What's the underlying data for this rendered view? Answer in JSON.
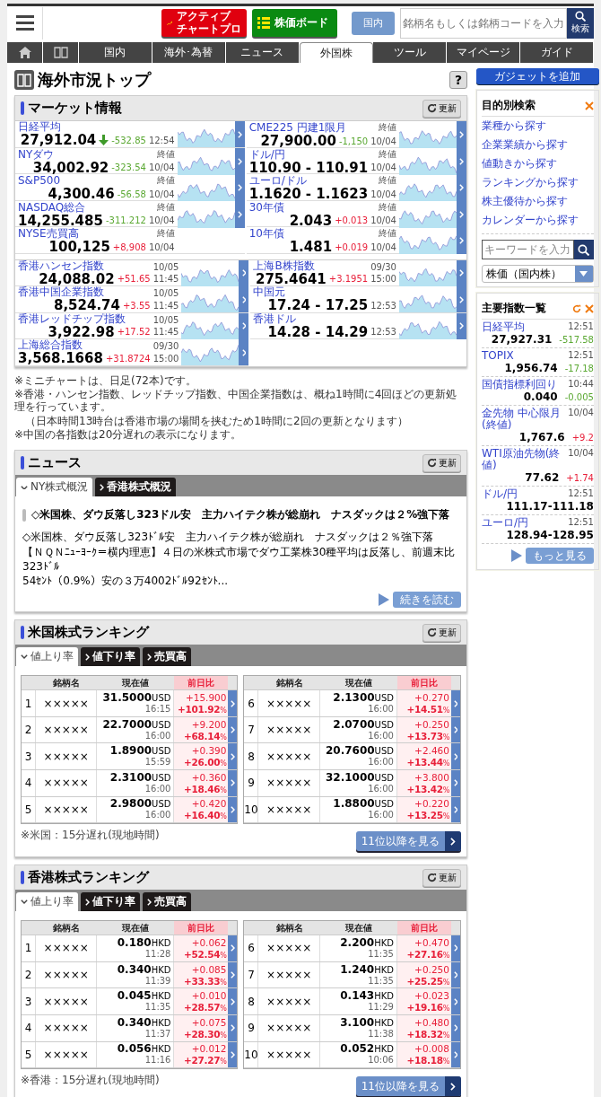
{
  "header": {
    "chart_button_lines": [
      "アクティブ",
      "チャートプロ"
    ],
    "board_button": "株価ボード",
    "market_button": "国内",
    "search_placeholder": "銘柄名もしくは銘柄コードを入力",
    "search_button": "検索"
  },
  "nav": [
    {
      "kind": "home",
      "selected": false
    },
    {
      "kind": "book",
      "selected": false
    },
    {
      "label": "国内",
      "selected": false
    },
    {
      "label": "海外･為替",
      "selected": false
    },
    {
      "label": "ニュース",
      "selected": false
    },
    {
      "label": "外国株",
      "selected": true
    },
    {
      "label": "ツール",
      "selected": false
    },
    {
      "label": "マイページ",
      "selected": false
    },
    {
      "label": "ガイド",
      "selected": false
    }
  ],
  "page_title": "海外市況トップ",
  "help_button": "?",
  "market": {
    "title": "マーケット情報",
    "update_label": "更新",
    "blocks": [
      {
        "left": [
          {
            "name": "日経平均",
            "value": "27,912.04",
            "arrow_icon": true,
            "change": "-532.85",
            "rising": false,
            "label_bottom": "12:54",
            "has_chart": true
          },
          {
            "name": "NYダウ",
            "value": "34,002.92",
            "change": "-323.54",
            "rising": false,
            "label_top": "終値",
            "label_bottom": "10/04",
            "has_chart": true
          },
          {
            "name": "S&P500",
            "value": "4,300.46",
            "change": "-56.58",
            "rising": false,
            "label_top": "終値",
            "label_bottom": "10/04",
            "has_chart": true
          },
          {
            "name": "NASDAQ総合",
            "value": "14,255.485",
            "change": "-311.212",
            "rising": false,
            "label_top": "終値",
            "label_bottom": "10/04",
            "has_chart": true
          },
          {
            "name": "NYSE売買高",
            "value": "100,125",
            "change": "+8,908",
            "rising": true,
            "label_top": "終値",
            "label_bottom": "10/04",
            "has_chart": false
          }
        ],
        "right": [
          {
            "name": "CME225 円建1限月",
            "value": "27,900.00",
            "change": "-1,150",
            "rising": false,
            "label_top": "終値",
            "label_bottom": "10/04",
            "has_chart": true
          },
          {
            "name": "ドル/円",
            "value": "110.90 - 110.91",
            "label_top": "終値",
            "label_bottom": "10/04",
            "has_chart": true
          },
          {
            "name": "ユーロ/ドル",
            "value": "1.1620 - 1.1623",
            "label_top": "終値",
            "label_bottom": "10/04",
            "has_chart": true
          },
          {
            "name": "30年債",
            "value": "2.043",
            "change": "+0.013",
            "rising": true,
            "label_top": "終値",
            "label_bottom": "10/04",
            "has_chart": true
          },
          {
            "name": "10年債",
            "value": "1.481",
            "change": "+0.019",
            "rising": true,
            "label_top": "終値",
            "label_bottom": "10/04",
            "has_chart": true
          }
        ]
      },
      {
        "left": [
          {
            "name": "香港ハンセン指数",
            "value": "24,088.02",
            "change": "+51.65",
            "rising": true,
            "label_top": "10/05",
            "label_bottom": "11:45",
            "has_chart": true
          },
          {
            "name": "香港中国企業指数",
            "value": "8,524.74",
            "change": "+3.55",
            "rising": true,
            "label_top": "10/05",
            "label_bottom": "11:45",
            "has_chart": true
          },
          {
            "name": "香港レッドチップ指数",
            "value": "3,922.98",
            "change": "+17.52",
            "rising": true,
            "label_top": "10/05",
            "label_bottom": "11:45",
            "has_chart": true
          },
          {
            "name": "上海総合指数",
            "value": "3,568.1668",
            "change": "+31.8724",
            "rising": true,
            "label_top": "09/30",
            "label_bottom": "15:00",
            "has_chart": true
          }
        ],
        "right": [
          {
            "name": "上海B株指数",
            "value": "275.4641",
            "change": "+3.1951",
            "rising": true,
            "label_top": "09/30",
            "label_bottom": "15:00",
            "has_chart": true
          },
          {
            "name": "中国元",
            "value": "17.24 - 17.25",
            "label_bottom": "12:53",
            "has_chart": true
          },
          {
            "name": "香港ドル",
            "value": "14.28 - 14.29",
            "label_bottom": "12:53",
            "has_chart": true
          }
        ]
      }
    ]
  },
  "notes": [
    "※ミニチャートは、日足(72本)です。",
    "※香港・ハンセン指数、レッドチップ指数、中国企業指数は、概ね1時間に4回ほどの更新処理を行っています。",
    "（日本時間13時台は香港市場の場間を挟むため1時間に2回の更新となります）",
    "※中国の各指数は20分遅れの表示になります。"
  ],
  "news": {
    "title": "ニュース",
    "update_label": "更新",
    "tabs": [
      {
        "label": "NY株式概況",
        "selected": true
      },
      {
        "label": "香港株式概況",
        "selected": false
      }
    ],
    "headline": "◇米国株、ダウ反落し323ドル安　主力ハイテク株が総崩れ　ナスダックは２%強下落",
    "body_lines": [
      "◇米国株、ダウ反落し323ﾄﾞﾙ安　主力ハイテク株が総崩れ　ナスダックは２％強下落",
      "【ＮＱＮﾆｭｰﾖｰｸ＝横内理恵】４日の米株式市場でダウ工業株30種平均は反落し、前週末比323ﾄﾞﾙ",
      "54ｾﾝﾄ（0.9%）安の３万4002ﾄﾞﾙ92ｾﾝﾄ..."
    ],
    "more_button": "続きを読む"
  },
  "rankings": [
    {
      "title": "米国株式ランキング",
      "update_label": "更新",
      "tabs": [
        {
          "label": "値上り率",
          "selected": true
        },
        {
          "label": "値下り率",
          "selected": false
        },
        {
          "label": "売買高",
          "selected": false
        }
      ],
      "tables": [
        {
          "headers": [
            "銘柄名",
            "現在値",
            "前日比"
          ],
          "rows": [
            {
              "rank": "1",
              "name": "×××××",
              "price": "31.5000",
              "currency": "USD",
              "time": "16:15",
              "change": "+15.900",
              "pct": "+101.92",
              "pct_unit": "%"
            },
            {
              "rank": "2",
              "name": "×××××",
              "price": "22.7000",
              "currency": "USD",
              "time": "16:00",
              "change": "+9.200",
              "pct": "+68.14",
              "pct_unit": "%"
            },
            {
              "rank": "3",
              "name": "×××××",
              "price": "1.8900",
              "currency": "USD",
              "time": "15:59",
              "change": "+0.390",
              "pct": "+26.00",
              "pct_unit": "%"
            },
            {
              "rank": "4",
              "name": "×××××",
              "price": "2.3100",
              "currency": "USD",
              "time": "16:00",
              "change": "+0.360",
              "pct": "+18.46",
              "pct_unit": "%"
            },
            {
              "rank": "5",
              "name": "×××××",
              "price": "2.9800",
              "currency": "USD",
              "time": "16:00",
              "change": "+0.420",
              "pct": "+16.40",
              "pct_unit": "%"
            }
          ]
        },
        {
          "headers": [
            "銘柄名",
            "現在値",
            "前日比"
          ],
          "rows": [
            {
              "rank": "6",
              "name": "×××××",
              "price": "2.1300",
              "currency": "USD",
              "time": "16:00",
              "change": "+0.270",
              "pct": "+14.51",
              "pct_unit": "%"
            },
            {
              "rank": "7",
              "name": "×××××",
              "price": "2.0700",
              "currency": "USD",
              "time": "16:00",
              "change": "+0.250",
              "pct": "+13.73",
              "pct_unit": "%"
            },
            {
              "rank": "8",
              "name": "×××××",
              "price": "20.7600",
              "currency": "USD",
              "time": "16:00",
              "change": "+2.460",
              "pct": "+13.44",
              "pct_unit": "%"
            },
            {
              "rank": "9",
              "name": "×××××",
              "price": "32.1000",
              "currency": "USD",
              "time": "16:00",
              "change": "+3.800",
              "pct": "+13.42",
              "pct_unit": "%"
            },
            {
              "rank": "10",
              "name": "×××××",
              "price": "1.8800",
              "currency": "USD",
              "time": "16:00",
              "change": "+0.220",
              "pct": "+13.25",
              "pct_unit": "%"
            }
          ]
        }
      ],
      "note": "※米国：15分遅れ(現地時間)",
      "more_button": "11位以降を見る"
    },
    {
      "title": "香港株式ランキング",
      "update_label": "更新",
      "tabs": [
        {
          "label": "値上り率",
          "selected": true
        },
        {
          "label": "値下り率",
          "selected": false
        },
        {
          "label": "売買高",
          "selected": false
        }
      ],
      "tables": [
        {
          "headers": [
            "銘柄名",
            "現在値",
            "前日比"
          ],
          "rows": [
            {
              "rank": "1",
              "name": "×××××",
              "price": "0.180",
              "currency": "HKD",
              "time": "11:28",
              "change": "+0.062",
              "pct": "+52.54",
              "pct_unit": "%"
            },
            {
              "rank": "2",
              "name": "×××××",
              "price": "0.340",
              "currency": "HKD",
              "time": "11:39",
              "change": "+0.085",
              "pct": "+33.33",
              "pct_unit": "%"
            },
            {
              "rank": "3",
              "name": "×××××",
              "price": "0.045",
              "currency": "HKD",
              "time": "11:35",
              "change": "+0.010",
              "pct": "+28.57",
              "pct_unit": "%"
            },
            {
              "rank": "4",
              "name": "×××××",
              "price": "0.340",
              "currency": "HKD",
              "time": "11:37",
              "change": "+0.075",
              "pct": "+28.30",
              "pct_unit": "%"
            },
            {
              "rank": "5",
              "name": "×××××",
              "price": "0.056",
              "currency": "HKD",
              "time": "11:16",
              "change": "+0.012",
              "pct": "+27.27",
              "pct_unit": "%"
            }
          ]
        },
        {
          "headers": [
            "銘柄名",
            "現在値",
            "前日比"
          ],
          "rows": [
            {
              "rank": "6",
              "name": "×××××",
              "price": "2.200",
              "currency": "HKD",
              "time": "11:35",
              "change": "+0.470",
              "pct": "+27.16",
              "pct_unit": "%"
            },
            {
              "rank": "7",
              "name": "×××××",
              "price": "1.240",
              "currency": "HKD",
              "time": "11:35",
              "change": "+0.250",
              "pct": "+25.25",
              "pct_unit": "%"
            },
            {
              "rank": "8",
              "name": "×××××",
              "price": "0.143",
              "currency": "HKD",
              "time": "11:29",
              "change": "+0.023",
              "pct": "+19.16",
              "pct_unit": "%"
            },
            {
              "rank": "9",
              "name": "×××××",
              "price": "3.100",
              "currency": "HKD",
              "time": "11:38",
              "change": "+0.480",
              "pct": "+18.32",
              "pct_unit": "%"
            },
            {
              "rank": "10",
              "name": "×××××",
              "price": "0.052",
              "currency": "HKD",
              "time": "10:06",
              "change": "+0.008",
              "pct": "+18.18",
              "pct_unit": "%"
            }
          ]
        }
      ],
      "note": "※香港：15分遅れ(現地時間)",
      "more_button": "11位以降を見る"
    }
  ],
  "sidebar": {
    "add_gadget_button": "ガジェットを追加",
    "purpose_search": {
      "title": "目的別検索",
      "links": [
        "業種から探す",
        "企業業績から探す",
        "値動きから探す",
        "ランキングから探す",
        "株主優待から探す",
        "カレンダーから探す"
      ],
      "keyword_placeholder": "キーワードを入力",
      "select_value": "株価（国内株）"
    },
    "indices": {
      "title": "主要指数一覧",
      "items": [
        {
          "name": "日経平均",
          "time": "12:51",
          "value": "27,927.31",
          "change": "-517.58",
          "rising": false
        },
        {
          "name": "TOPIX",
          "time": "12:51",
          "value": "1,956.74",
          "change": "-17.18",
          "rising": false
        },
        {
          "name": "国債指標利回り",
          "time": "10:44",
          "value": "0.040",
          "change": "-0.005",
          "rising": false
        },
        {
          "name": "金先物 中心限月(終値)",
          "time": "10/04",
          "value": "1,767.6",
          "change": "+9.2",
          "rising": true
        },
        {
          "name": "WTI原油先物(終値)",
          "time": "10/04",
          "value": "77.62",
          "change": "+1.74",
          "rising": true
        },
        {
          "name": "ドル/円",
          "time": "12:51",
          "value": "111.17-111.18"
        },
        {
          "name": "ユーロ/円",
          "time": "12:51",
          "value": "128.94-128.95"
        }
      ],
      "more_button": "もっと見る"
    }
  }
}
